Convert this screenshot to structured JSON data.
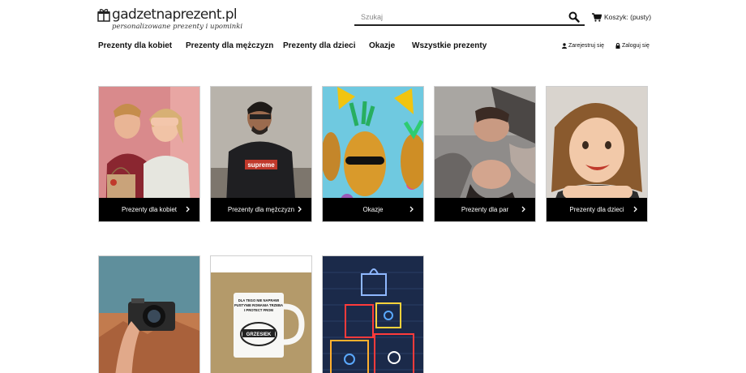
{
  "brand": {
    "name": "gadzetnaprezent.pl",
    "tagline": "personalizowane prezenty i upominki"
  },
  "search": {
    "placeholder": "Szukaj",
    "icon": "search-icon"
  },
  "cart": {
    "label": "Koszyk: (pusty)",
    "icon": "cart-icon"
  },
  "nav": {
    "items": [
      {
        "label": "Prezenty dla kobiet"
      },
      {
        "label": "Prezenty dla mężczyzn"
      },
      {
        "label": "Prezenty dla dzieci"
      },
      {
        "label": "Okazje"
      },
      {
        "label": "Wszystkie prezenty"
      }
    ]
  },
  "account": {
    "register_label": "Zarejestruj się",
    "login_label": "Zaloguj się",
    "icon": "user-icon",
    "login_icon": "lock-icon"
  },
  "categories": [
    {
      "label": "Prezenty dla kobiet",
      "icon": "chevron-right-icon"
    },
    {
      "label": "Prezenty dla mężczyzn",
      "icon": "chevron-right-icon"
    },
    {
      "label": "Okazje",
      "icon": "chevron-right-icon"
    },
    {
      "label": "Prezenty dla par",
      "icon": "chevron-right-icon"
    },
    {
      "label": "Prezenty dla dzieci",
      "icon": "chevron-right-icon"
    }
  ],
  "photo_tiles": {
    "shirt_text": "supreme",
    "mug_lines": [
      "DLA TEGO NIE NAPRAWI",
      "PUSTYNIE ROMANIA TRZEBA",
      "I PROTECT FROM"
    ],
    "mug_name": "GRZESIEK"
  },
  "colors": {
    "bar": "#000000",
    "text": "#111111",
    "border": "#cfcfcf"
  }
}
